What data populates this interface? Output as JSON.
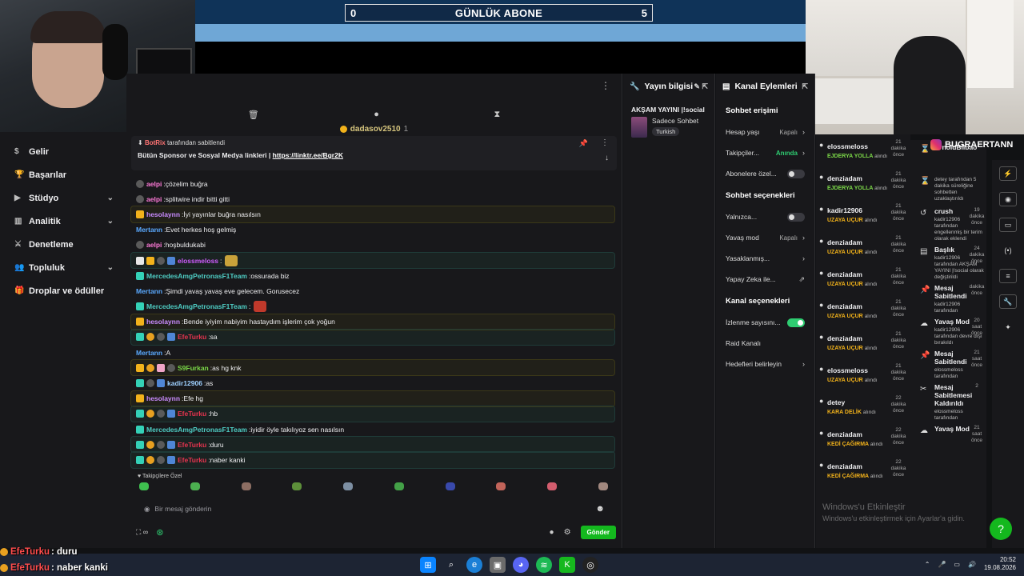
{
  "subscriber_bar": {
    "title": "GÜNLÜK ABONE",
    "left_value": "0",
    "right_value": "5"
  },
  "nav": {
    "items": [
      {
        "label": "Gelir",
        "icon": "dollar-icon"
      },
      {
        "label": "Başarılar",
        "icon": "trophy-icon"
      },
      {
        "label": "Stüdyo",
        "icon": "studio-icon",
        "expandable": true
      },
      {
        "label": "Analitik",
        "icon": "chart-icon",
        "expandable": true
      },
      {
        "label": "Denetleme",
        "icon": "sword-icon"
      },
      {
        "label": "Topluluk",
        "icon": "people-icon",
        "expandable": true
      },
      {
        "label": "Droplar ve ödüller",
        "icon": "gift-icon"
      }
    ]
  },
  "chat": {
    "gift_banner": {
      "user": "dadasov2510",
      "count": "1"
    },
    "pinned": {
      "by_user": "BotRix",
      "by_suffix": " tarafından sabitlendi",
      "text": "Bütün Sponsor ve Sosyal Medya linkleri | ",
      "link": "https://linktr.ee/Bgr2K"
    },
    "messages": [
      {
        "user": "aelpi",
        "color": "#ff7ad9",
        "text": "çözelim buğra",
        "badges": [
          "b-grey"
        ],
        "hl": ""
      },
      {
        "user": "aelpi",
        "color": "#ff7ad9",
        "text": "splitwire indir bitti gitti",
        "badges": [
          "b-grey"
        ],
        "hl": ""
      },
      {
        "user": "hesolaynn",
        "color": "#c98bff",
        "text": "İyi yayınlar buğra nasılsın",
        "badges": [
          "b-gold"
        ],
        "hl": "hl-gold"
      },
      {
        "user": "Mertann",
        "color": "#5aa9ff",
        "text": "Evet herkes hoş gelmiş",
        "badges": [],
        "hl": ""
      },
      {
        "user": "aelpi",
        "color": "#ff7ad9",
        "text": "hoşbuldukabi",
        "badges": [
          "b-grey"
        ],
        "hl": ""
      },
      {
        "user": "elossmeloss",
        "color": "#d05cff",
        "text": "",
        "badges": [
          "b-prime",
          "b-gold",
          "b-grey",
          "b-blue"
        ],
        "hl": "hl-teal",
        "emote": "#c9a23a"
      },
      {
        "user": "MercedesAmgPetronasF1Team",
        "color": "#4ecdc4",
        "text": "ossurada biz",
        "badges": [
          "b-teal"
        ],
        "hl": ""
      },
      {
        "user": "Mertann",
        "color": "#5aa9ff",
        "text": "Şimdi yavaş yavaş eve gelecem. Gorusecez",
        "badges": [],
        "hl": ""
      },
      {
        "user": "MercedesAmgPetronasF1Team",
        "color": "#4ecdc4",
        "text": "",
        "badges": [
          "b-teal"
        ],
        "hl": "",
        "emote": "#c0392b"
      },
      {
        "user": "hesolaynn",
        "color": "#c98bff",
        "text": "Bende iyiyim nabiyim hastaydım işlerim çok yoğun",
        "badges": [
          "b-gold"
        ],
        "hl": "hl-gold"
      },
      {
        "user": "EfeTurku",
        "color": "#e8344f",
        "text": "sa",
        "badges": [
          "b-teal",
          "b-orange",
          "b-grey",
          "b-blue"
        ],
        "hl": "hl-teal"
      },
      {
        "user": "Mertann",
        "color": "#5aa9ff",
        "text": "A",
        "badges": [],
        "hl": ""
      },
      {
        "user": "S9Furkan",
        "color": "#7bd848",
        "text": "as hg knk",
        "badges": [
          "b-gold",
          "b-orange",
          "b-pink",
          "b-grey"
        ],
        "hl": "hl-gold"
      },
      {
        "user": "kadir12906",
        "color": "#9ed0ff",
        "text": "as",
        "badges": [
          "b-teal",
          "b-grey",
          "b-blue"
        ],
        "hl": ""
      },
      {
        "user": "hesolaynn",
        "color": "#c98bff",
        "text": "Efe hg",
        "badges": [
          "b-gold"
        ],
        "hl": "hl-gold"
      },
      {
        "user": "EfeTurku",
        "color": "#e8344f",
        "text": "hb",
        "badges": [
          "b-teal",
          "b-orange",
          "b-grey",
          "b-blue"
        ],
        "hl": "hl-teal"
      },
      {
        "user": "MercedesAmgPetronasF1Team",
        "color": "#4ecdc4",
        "text": "iyidir öyle takılıyoz sen nasılsın",
        "badges": [
          "b-teal"
        ],
        "hl": ""
      },
      {
        "user": "EfeTurku",
        "color": "#e8344f",
        "text": "duru",
        "badges": [
          "b-teal",
          "b-orange",
          "b-grey",
          "b-blue"
        ],
        "hl": "hl-teal"
      },
      {
        "user": "EfeTurku",
        "color": "#e8344f",
        "text": "naber kanki",
        "badges": [
          "b-teal",
          "b-orange",
          "b-grey",
          "b-blue"
        ],
        "hl": "hl-teal"
      }
    ],
    "emote_label": "Takipçilere Özel",
    "input_placeholder": "Bir mesaj gönderin",
    "send_label": "Gönder"
  },
  "stream_info": {
    "header": "Yayın bilgisi",
    "title": "AKŞAM YAYINI |!social",
    "category": "Sadece Sohbet",
    "tag": "Turkish"
  },
  "channel_actions": {
    "header": "Kanal Eylemleri",
    "sections": [
      {
        "title": "Sohbet erişimi",
        "rows": [
          {
            "label": "Hesap yaşı",
            "value": "Kapalı",
            "ctrl": "arrow"
          },
          {
            "label": "Takipçiler...",
            "value": "Anında",
            "green": true,
            "ctrl": "arrow"
          },
          {
            "label": "Abonelere özel...",
            "value": "",
            "ctrl": "toggle-off"
          }
        ]
      },
      {
        "title": "Sohbet seçenekleri",
        "rows": [
          {
            "label": "Yalnızca...",
            "value": "",
            "ctrl": "toggle-off"
          },
          {
            "label": "Yavaş mod",
            "value": "Kapalı",
            "ctrl": "arrow"
          },
          {
            "label": "Yasaklanmış...",
            "value": "",
            "ctrl": "arrow"
          },
          {
            "label": "Yapay Zeka ile...",
            "value": "",
            "ctrl": "ext"
          }
        ]
      },
      {
        "title": "Kanal seçenekleri",
        "rows": [
          {
            "label": "İzlenme sayısını...",
            "value": "",
            "ctrl": "toggle-on"
          },
          {
            "label": "Raid Kanalı",
            "value": "",
            "ctrl": "none"
          },
          {
            "label": "Hedefleri belirleyin",
            "value": "",
            "ctrl": "arrow"
          }
        ]
      }
    ]
  },
  "activity": [
    {
      "name": "elossmeloss",
      "when": "21 dakika önce",
      "action": "EJDERYA YOLLA",
      "note": "alındı",
      "color": "#7bd848"
    },
    {
      "name": "denziadam",
      "when": "21 dakika önce",
      "action": "EJDERYA YOLLA",
      "note": "alındı",
      "color": "#7bd848"
    },
    {
      "name": "kadir12906",
      "when": "21 dakika önce",
      "action": "UZAYA UÇUR",
      "note": "alındı",
      "color": "#f2b21b"
    },
    {
      "name": "denziadam",
      "when": "21 dakika önce",
      "action": "UZAYA UÇUR",
      "note": "alındı",
      "color": "#f2b21b"
    },
    {
      "name": "denziadam",
      "when": "21 dakika önce",
      "action": "UZAYA UÇUR",
      "note": "alındı",
      "color": "#f2b21b"
    },
    {
      "name": "denziadam",
      "when": "21 dakika önce",
      "action": "UZAYA UÇUR",
      "note": "alındı",
      "color": "#f2b21b"
    },
    {
      "name": "denziadam",
      "when": "21 dakika önce",
      "action": "UZAYA UÇUR",
      "note": "alındı",
      "color": "#f2b21b"
    },
    {
      "name": "elossmeloss",
      "when": "21 dakika önce",
      "action": "UZAYA UÇUR",
      "note": "alındı",
      "color": "#f2b21b"
    },
    {
      "name": "detey",
      "when": "22 dakika önce",
      "action": "KARA DELİK",
      "note": "alındı",
      "color": "#f2b21b"
    },
    {
      "name": "denziadam",
      "when": "22 dakika önce",
      "action": "KEDİ ÇAĞIRMA",
      "note": "alındı",
      "color": "#f2b21b"
    },
    {
      "name": "denziadam",
      "when": "22 dakika önce",
      "action": "KEDİ ÇAĞIRMA",
      "note": "alındı",
      "color": "#f2b21b"
    }
  ],
  "ig_handle": "BUGRAERTANN",
  "modlog": [
    {
      "icon": "⌛",
      "title": "ArnoldBilbao",
      "when": "",
      "desc": ""
    },
    {
      "icon": "⌛",
      "title": "",
      "when": "",
      "desc": "detey tarafından 5 dakika süreliğine sohbetten uzaklaştırıldı"
    },
    {
      "icon": "↺",
      "title": "crush",
      "when": "19 dakika önce",
      "desc": "kadir12906 tarafından engellenmiş bir terim olarak eklendi"
    },
    {
      "icon": "▤",
      "title": "Başlık",
      "when": "24 dakika önce",
      "desc": "kadir12906 tarafından AKŞAM YAYINI |!social olarak değiştirildi"
    },
    {
      "icon": "📌",
      "title": "Mesaj Sabitlendi",
      "when": "dakika önce",
      "desc": "kadir12906 tarafından"
    },
    {
      "icon": "☁",
      "title": "Yavaş Mod",
      "when": "20 saat önce",
      "desc": "kadir12906 tarafından devre dışı bırakıldı"
    },
    {
      "icon": "📌",
      "title": "Mesaj Sabitlendi",
      "when": "21 saat önce",
      "desc": "elossmeloss tarafından"
    },
    {
      "icon": "✂",
      "title": "Mesaj Sabitlemesi Kaldırıldı",
      "when": "2",
      "desc": "elossmeloss tarafından"
    },
    {
      "icon": "☁",
      "title": "Yavaş Mod",
      "when": "21 saat önce",
      "desc": ""
    }
  ],
  "watermark": {
    "line1": "Windows'u Etkinleştir",
    "line2": "Windows'u etkinleştirmek için Ayarlar'a gidin."
  },
  "overlay_chat": [
    {
      "user": "EfeTurku",
      "text": ": duru"
    },
    {
      "user": "EfeTurku",
      "text": ": naber kanki"
    }
  ],
  "taskbar": {
    "time": "20:52",
    "date": "19.08.2026"
  }
}
